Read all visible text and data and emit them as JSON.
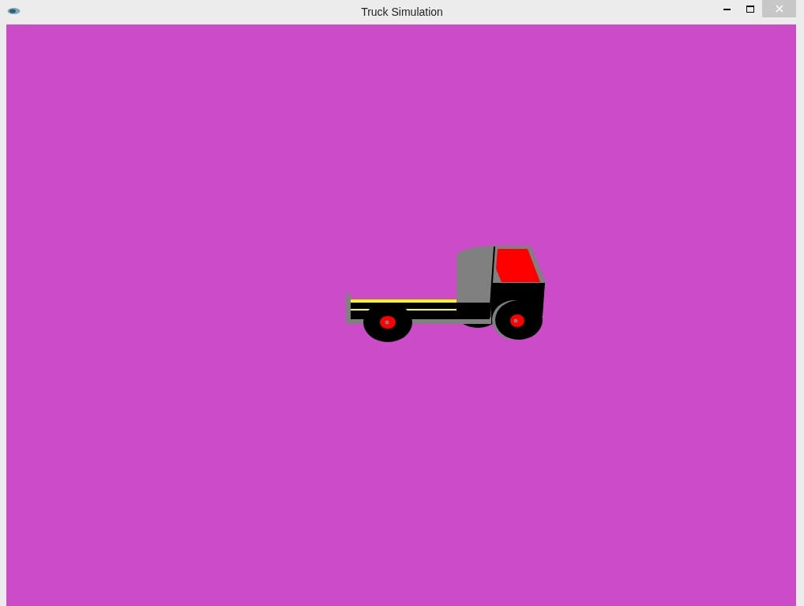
{
  "window": {
    "title": "Truck Simulation"
  }
}
